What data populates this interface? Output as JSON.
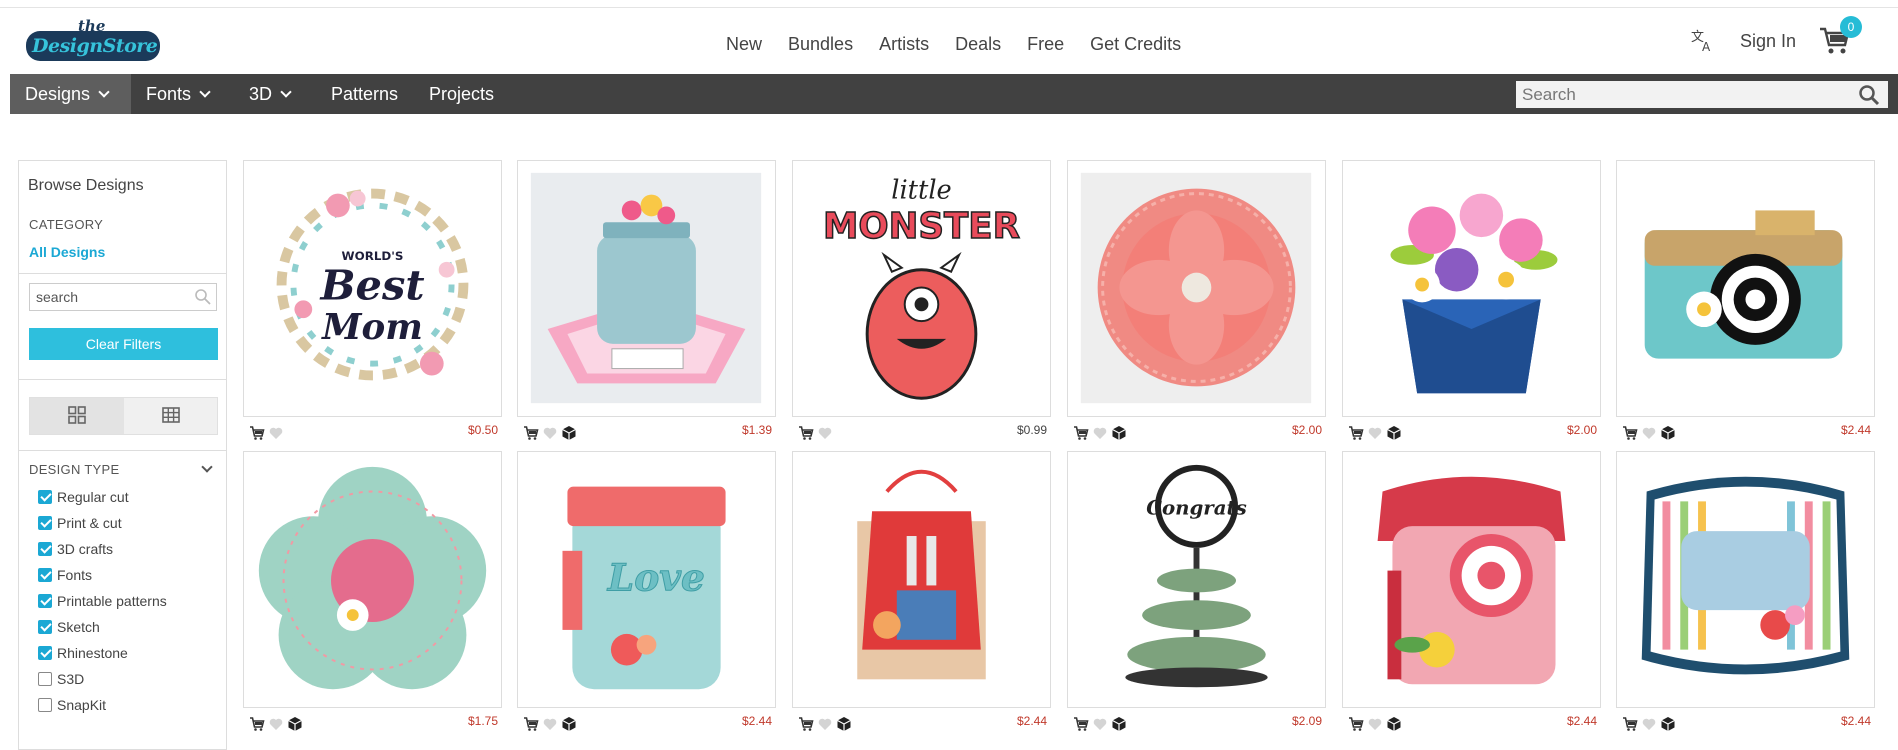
{
  "brand": {
    "logo_small": "the",
    "logo_main": "DesignStore"
  },
  "nav": {
    "items": [
      "New",
      "Bundles",
      "Artists",
      "Deals",
      "Free",
      "Get Credits"
    ]
  },
  "header": {
    "sign_in": "Sign In",
    "cart_count": "0"
  },
  "categories": [
    {
      "label": "Designs",
      "dropdown": true,
      "active": true
    },
    {
      "label": "Fonts",
      "dropdown": true
    },
    {
      "label": "3D",
      "dropdown": true
    },
    {
      "label": "Patterns",
      "dropdown": false
    },
    {
      "label": "Projects",
      "dropdown": false
    }
  ],
  "search": {
    "placeholder": "Search"
  },
  "sidebar": {
    "title": "Browse Designs",
    "category_label": "CATEGORY",
    "all_designs": "All Designs",
    "search_placeholder": "search",
    "clear_filters": "Clear Filters",
    "design_type_label": "DESIGN TYPE",
    "design_types": [
      {
        "label": "Regular cut",
        "checked": true
      },
      {
        "label": "Print & cut",
        "checked": true
      },
      {
        "label": "3D crafts",
        "checked": true
      },
      {
        "label": "Fonts",
        "checked": true
      },
      {
        "label": "Printable patterns",
        "checked": true
      },
      {
        "label": "Sketch",
        "checked": true
      },
      {
        "label": "Rhinestone",
        "checked": true
      },
      {
        "label": "S3D",
        "checked": false
      },
      {
        "label": "SnapKit",
        "checked": false
      }
    ]
  },
  "products": [
    {
      "price": "$0.50",
      "has_3d": false,
      "image": "worlds-best-mom-wreath"
    },
    {
      "price": "$1.39",
      "has_3d": true,
      "image": "mason-jar-card"
    },
    {
      "price": "$0.99",
      "has_3d": false,
      "image": "little-monster"
    },
    {
      "price": "$2.00",
      "has_3d": true,
      "image": "lace-flower-rosette"
    },
    {
      "price": "$2.00",
      "has_3d": true,
      "image": "flower-box-bouquet"
    },
    {
      "price": "$2.44",
      "has_3d": true,
      "image": "camera-box"
    },
    {
      "price": "$1.75",
      "has_3d": true,
      "image": "flower-shaped-box"
    },
    {
      "price": "$2.44",
      "has_3d": true,
      "image": "love-mason-jar-box"
    },
    {
      "price": "$2.44",
      "has_3d": true,
      "image": "apron-gift-bag"
    },
    {
      "price": "$2.09",
      "has_3d": true,
      "image": "congrats-money-cake"
    },
    {
      "price": "$2.44",
      "has_3d": true,
      "image": "rotary-telephone-box"
    },
    {
      "price": "$2.44",
      "has_3d": true,
      "image": "layered-frame-card"
    }
  ],
  "colors": {
    "accent": "#2ebfdd",
    "link": "#1ba8d4",
    "price": "#c0392b",
    "navbar": "#414141"
  }
}
